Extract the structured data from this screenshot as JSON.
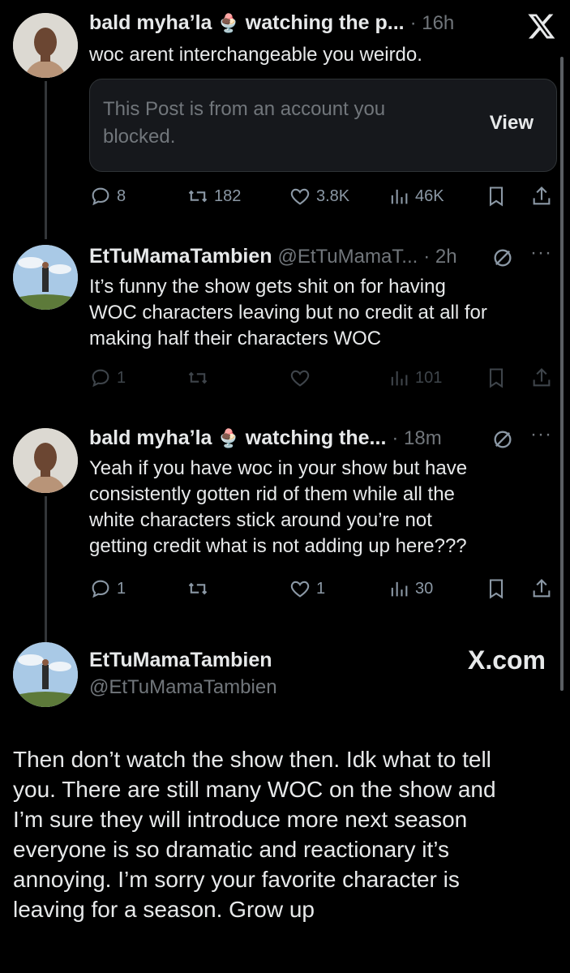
{
  "tweets": [
    {
      "display_name": "bald myha’la",
      "emoji": "🍨",
      "display_suffix": "watching the p...",
      "time": "· 16h",
      "text": "woc arent interchangeable you weirdo.",
      "blocked_notice": "This Post is from an account you blocked.",
      "blocked_line1": "This Post is from an account you",
      "blocked_line2": "blocked.",
      "view_label": "View",
      "replies": "8",
      "reposts": "182",
      "likes": "3.8K",
      "views": "46K"
    },
    {
      "display_name": "EtTuMamaTambien",
      "handle": "@EtTuMamaT...",
      "time": "· 2h",
      "lines": [
        "It’s funny the show gets shit on for having",
        "WOC characters leaving but no credit at all for",
        "making half their characters WOC"
      ],
      "replies": "1",
      "views": "101"
    },
    {
      "display_name": "bald myha’la",
      "emoji": "🍨",
      "display_suffix": "watching the...",
      "time": "· 18m",
      "lines": [
        "Yeah if you have woc in your show but have",
        "consistently gotten rid of them while all the",
        "white characters stick around you’re not",
        "getting credit what is not adding up here???"
      ],
      "replies": "1",
      "likes": "1",
      "views": "30"
    }
  ],
  "main_post": {
    "display_name": "EtTuMamaTambien",
    "handle": "@EtTuMamaTambien",
    "watermark": "X.com",
    "lines": [
      "Then don’t watch the show then. Idk what to tell",
      "you. There are still many WOC on the show and",
      "I’m sure they will introduce more next season",
      "everyone is so dramatic and reactionary it’s",
      "annoying. I’m sorry your favorite character is",
      "leaving for a season. Grow up"
    ]
  },
  "icons": {
    "close": "close-x-icon",
    "reply": "reply-icon",
    "repost": "repost-icon",
    "like": "heart-icon",
    "views": "views-chart-icon",
    "bookmark": "bookmark-icon",
    "share": "share-icon",
    "muted": "muted-icon",
    "more": "more-icon"
  },
  "colors": {
    "background": "#000000",
    "text": "#e7e9ea",
    "secondary": "#71767b"
  }
}
